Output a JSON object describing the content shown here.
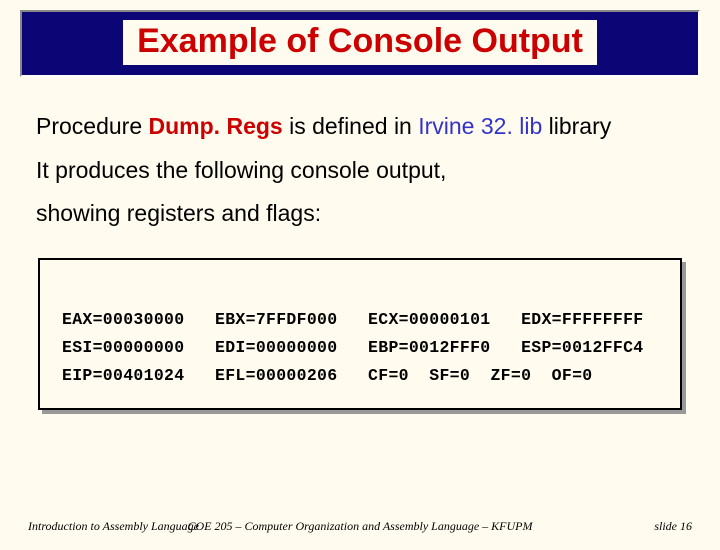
{
  "title": "Example of Console Output",
  "body": {
    "word_procedure": "Procedure ",
    "proc_name": "Dump. Regs",
    "word_isdef": " is defined in ",
    "lib_name": "Irvine 32. lib",
    "word_library": " library",
    "line2": "It produces the following console output,",
    "line3": "showing registers and flags:"
  },
  "console": {
    "row1": "EAX=00030000   EBX=7FFDF000   ECX=00000101   EDX=FFFFFFFF",
    "row2": "ESI=00000000   EDI=00000000   EBP=0012FFF0   ESP=0012FFC4",
    "row3": "EIP=00401024   EFL=00000206   CF=0  SF=0  ZF=0  OF=0"
  },
  "footer": {
    "left": "Introduction to Assembly Language",
    "center": "COE 205 – Computer Organization and Assembly Language – KFUPM",
    "right": "slide 16"
  }
}
